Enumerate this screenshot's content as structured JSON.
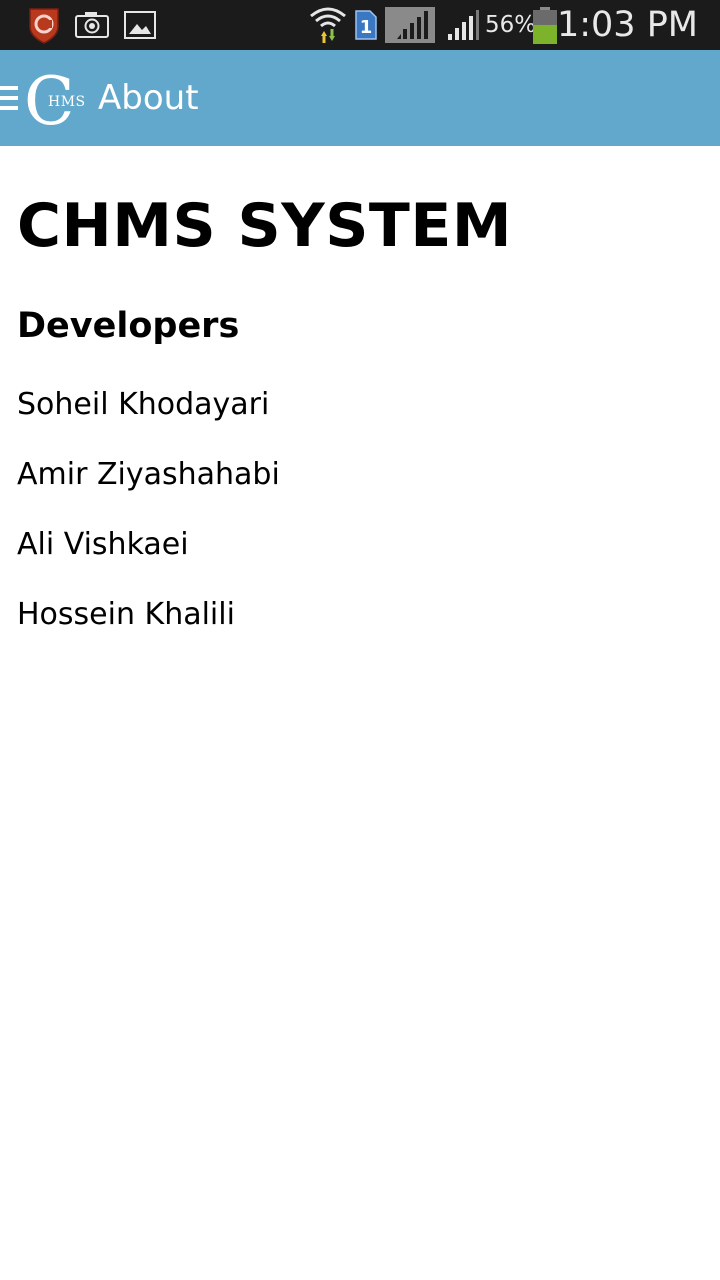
{
  "status_bar": {
    "battery_percent": "56%",
    "battery_level": 0.56,
    "time": "1:03 PM",
    "icons": [
      "antivirus-icon",
      "camera-icon",
      "gallery-icon",
      "wifi-icon",
      "sim-1-icon",
      "signal-icon",
      "signal-icon",
      "battery-icon"
    ],
    "battery_fill_color": "#7cb32a",
    "antivirus_color": "#c0391f"
  },
  "action_bar": {
    "title": "About",
    "logo_letter": "C",
    "logo_small_text": "HMS",
    "background_color": "#62a8cd"
  },
  "content": {
    "title": "CHMS SYSTEM",
    "section_heading": "Developers",
    "developers": [
      "Soheil Khodayari",
      "Amir Ziyashahabi",
      "Ali Vishkaei",
      "Hossein Khalili"
    ]
  }
}
